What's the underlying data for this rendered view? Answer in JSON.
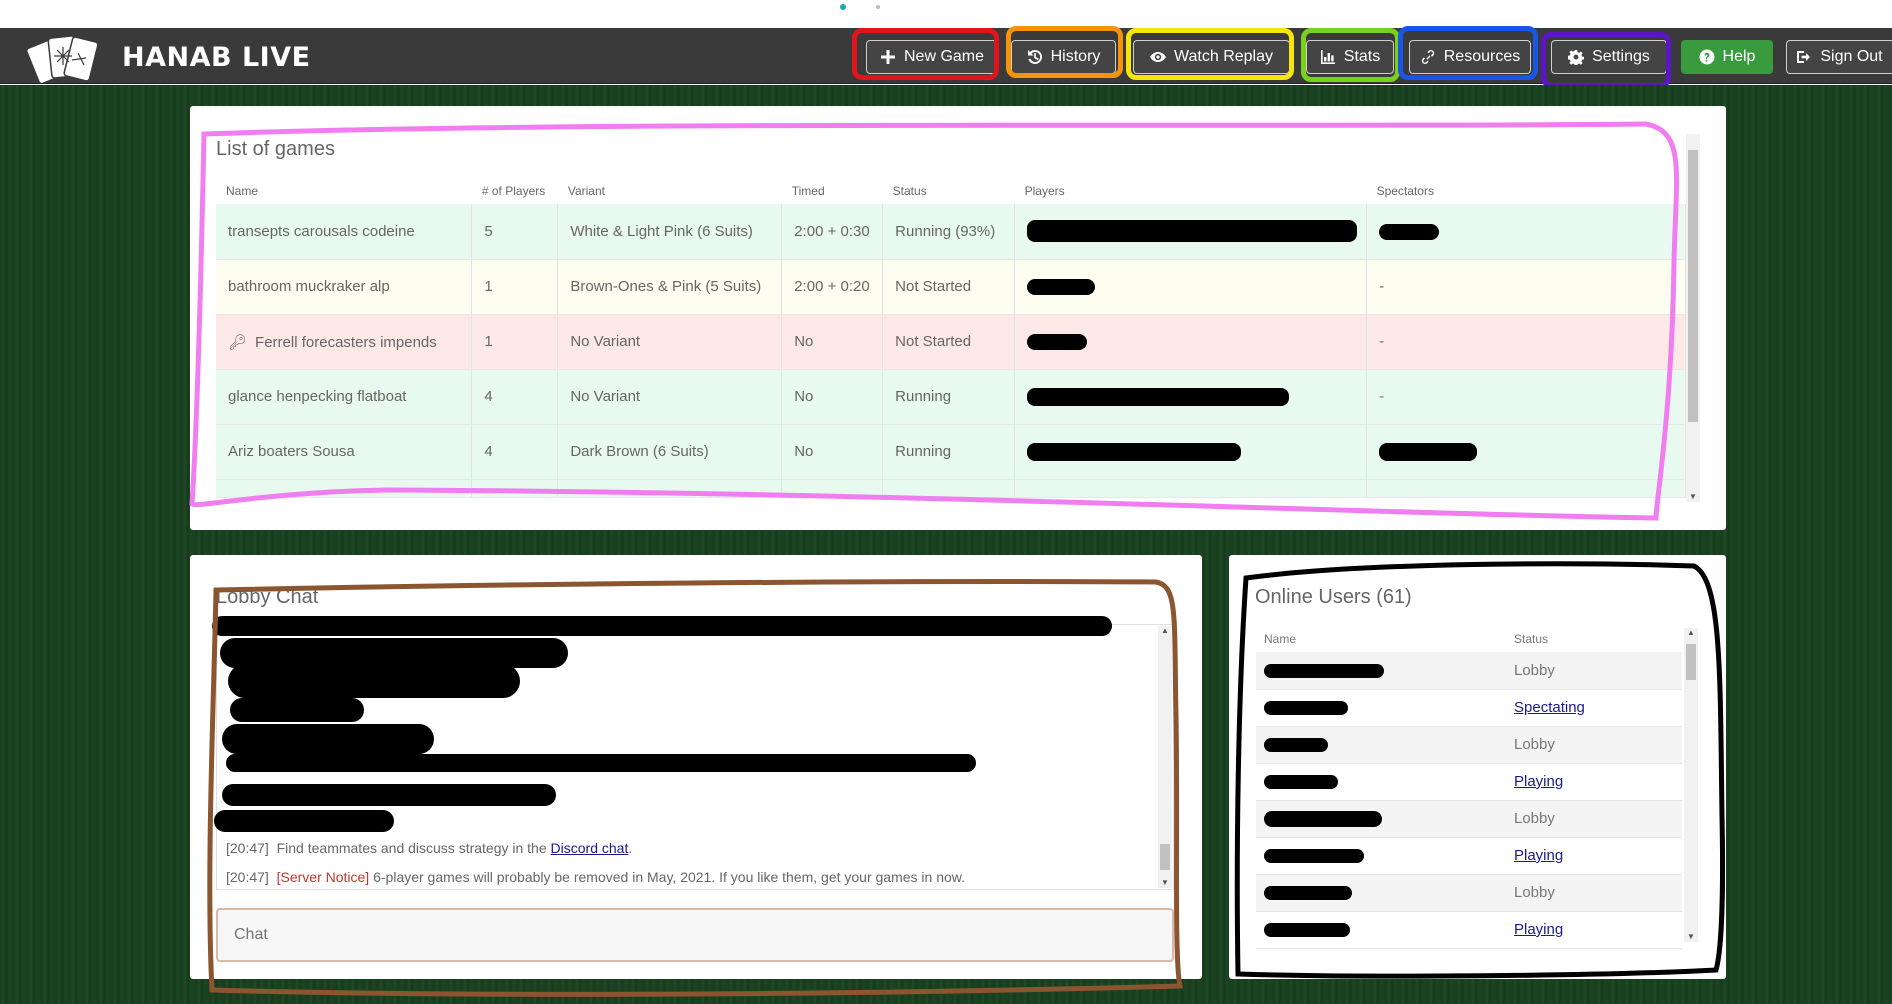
{
  "app": {
    "brand": "HANAB LIVE"
  },
  "nav": {
    "new_game": "New Game",
    "history": "History",
    "watch_replay": "Watch Replay",
    "stats": "Stats",
    "resources": "Resources",
    "settings": "Settings",
    "help": "Help",
    "sign_out": "Sign Out"
  },
  "games": {
    "title": "List of games",
    "headers": [
      "Name",
      "# of Players",
      "Variant",
      "Timed",
      "Status",
      "Players",
      "Spectators"
    ],
    "rows": [
      {
        "name": "transepts carousals codeine",
        "players_count": "5",
        "variant": "White & Light Pink (6 Suits)",
        "timed": "2:00 + 0:30",
        "status": "Running (93%)",
        "spectators": ""
      },
      {
        "name": "bathroom muckraker alp",
        "players_count": "1",
        "variant": "Brown-Ones & Pink (5 Suits)",
        "timed": "2:00 + 0:20",
        "status": "Not Started",
        "spectators": "-"
      },
      {
        "name": "Ferrell forecasters impends",
        "players_count": "1",
        "variant": "No Variant",
        "timed": "No",
        "status": "Not Started",
        "spectators": "-"
      },
      {
        "name": "glance henpecking flatboat",
        "players_count": "4",
        "variant": "No Variant",
        "timed": "No",
        "status": "Running",
        "spectators": "-"
      },
      {
        "name": "Ariz boaters Sousa",
        "players_count": "4",
        "variant": "Dark Brown (6 Suits)",
        "timed": "No",
        "status": "Running",
        "spectators": ""
      }
    ]
  },
  "chat": {
    "title": "Lobby Chat",
    "lines": [
      {
        "time": "[20:47]",
        "prefix": "",
        "text": "Find teammates and discuss strategy in the ",
        "link": "Discord chat",
        "suffix": "."
      },
      {
        "time": "[20:47]",
        "prefix": "[Server Notice]",
        "text": " 6-player games will probably be removed in May, 2021. If you like them, get your games in now.",
        "link": "",
        "suffix": ""
      }
    ],
    "input_placeholder": "Chat"
  },
  "users": {
    "title": "Online Users (61)",
    "headers": [
      "Name",
      "Status"
    ],
    "rows": [
      {
        "status": "Lobby",
        "link": false
      },
      {
        "status": "Spectating",
        "link": true
      },
      {
        "status": "Lobby",
        "link": false
      },
      {
        "status": "Playing",
        "link": true
      },
      {
        "status": "Lobby",
        "link": false
      },
      {
        "status": "Playing",
        "link": true
      },
      {
        "status": "Lobby",
        "link": false
      },
      {
        "status": "Playing",
        "link": true
      }
    ]
  },
  "colors": {
    "navbar": "#3a3a3a",
    "help_button": "#3a9a3e",
    "row_running": "#e8faef",
    "row_not_started": "#fdfdf0",
    "row_password": "#fde8e8",
    "table_background": "#1c4423",
    "highlight_new_game": "#e0141c",
    "highlight_history": "#f5940a",
    "highlight_watch_replay": "#f5e50a",
    "highlight_stats": "#7ad11d",
    "highlight_resources": "#1a56e6",
    "highlight_settings": "#5b14c8",
    "highlight_games": "#f07ef0",
    "highlight_chat": "#8b5530",
    "highlight_users": "#000000"
  }
}
